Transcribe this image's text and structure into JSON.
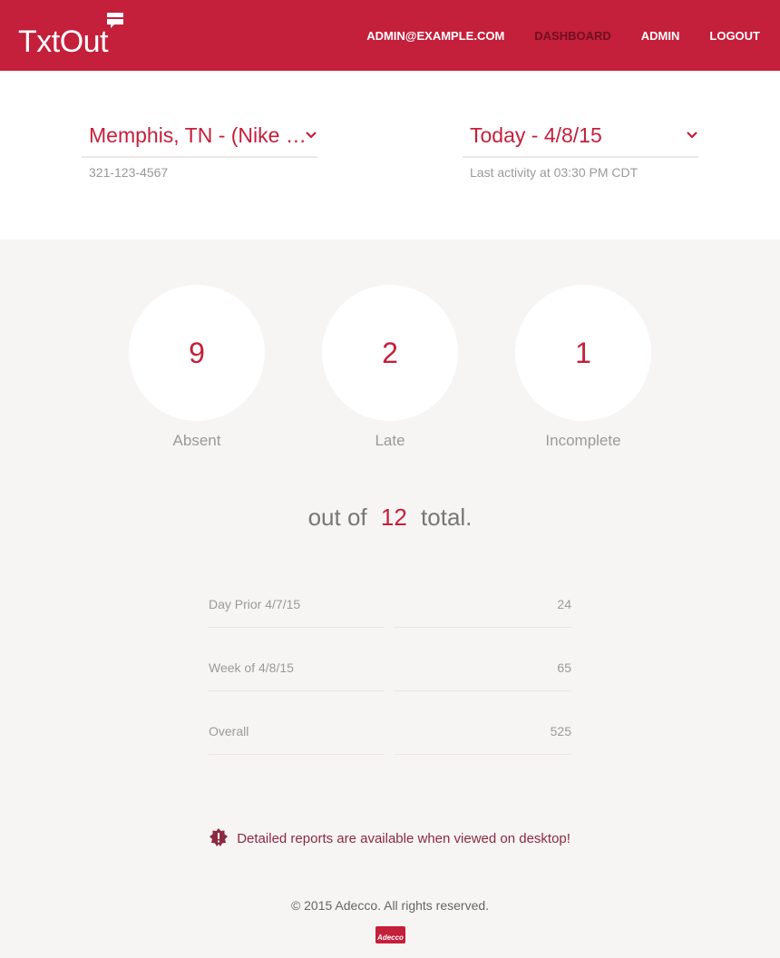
{
  "header": {
    "logo_text": "TxtOut",
    "nav": [
      {
        "label": "ADMIN@EXAMPLE.COM",
        "active": false
      },
      {
        "label": "DASHBOARD",
        "active": true
      },
      {
        "label": "ADMIN",
        "active": false
      },
      {
        "label": "LOGOUT",
        "active": false
      }
    ]
  },
  "location_select": {
    "value": "Memphis, TN - (Nike …",
    "phone": "321-123-4567"
  },
  "date_select": {
    "value": "Today - 4/8/15",
    "last_activity": "Last activity at 03:30 PM CDT"
  },
  "stats": {
    "absent": {
      "value": "9",
      "label": "Absent"
    },
    "late": {
      "value": "2",
      "label": "Late"
    },
    "incomplete": {
      "value": "1",
      "label": "Incomplete"
    }
  },
  "total": {
    "prefix": "out of",
    "value": "12",
    "suffix": "total."
  },
  "summary_rows": [
    {
      "label": "Day Prior 4/7/15",
      "value": "24"
    },
    {
      "label": "Week of 4/8/15",
      "value": "65"
    },
    {
      "label": "Overall",
      "value": "525"
    }
  ],
  "notice": {
    "text": "Detailed reports are available when viewed on desktop!",
    "icon": "alert-badge-icon"
  },
  "footer": {
    "copyright": "© 2015 Adecco. All rights reserved.",
    "brand_badge": "Adecco"
  },
  "colors": {
    "accent": "#c41f3b",
    "nav_active": "#6e1020",
    "background": "#f7f5f4"
  }
}
